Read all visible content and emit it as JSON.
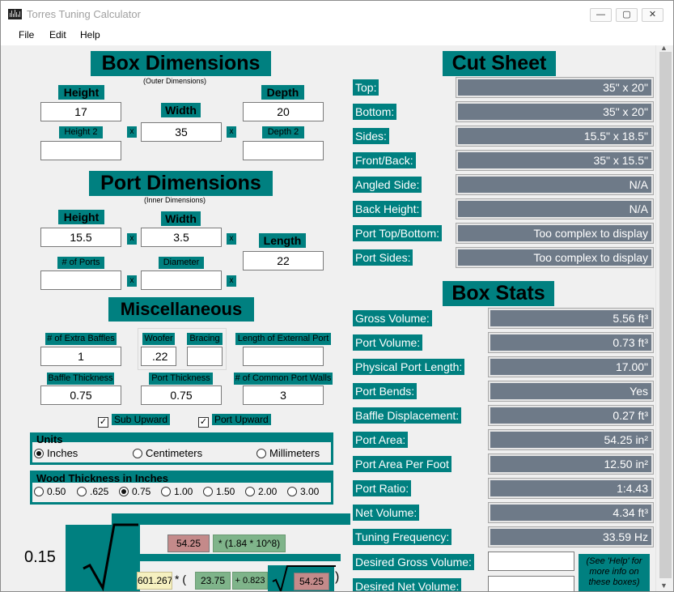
{
  "window": {
    "title": "Torres Tuning Calculator",
    "minimize": "—",
    "maximize": "▢",
    "close": "✕"
  },
  "menu": [
    "File",
    "Edit",
    "Help"
  ],
  "box": {
    "heading": "Box Dimensions",
    "subheading": "(Outer Dimensions)",
    "height_label": "Height",
    "height": "17",
    "width_label": "Width",
    "width": "35",
    "depth_label": "Depth",
    "depth": "20",
    "height2_label": "Height 2",
    "height2": "",
    "depth2_label": "Depth 2",
    "depth2": ""
  },
  "port": {
    "heading": "Port Dimensions",
    "subheading": "(Inner Dimensions)",
    "height_label": "Height",
    "height": "15.5",
    "width_label": "Width",
    "width": "3.5",
    "length_label": "Length",
    "length": "22",
    "ports_label": "# of Ports",
    "ports": "",
    "diameter_label": "Diameter",
    "diameter": ""
  },
  "x_mark": "x",
  "misc": {
    "heading": "Miscellaneous",
    "extra_baffles_label": "# of Extra Baffles",
    "extra_baffles": "1",
    "woofer_label": "Woofer",
    "woofer": ".22",
    "bracing_label": "Bracing",
    "bracing": "",
    "ext_port_label": "Length of External Port",
    "ext_port": "",
    "baffle_thickness_label": "Baffle Thickness",
    "baffle_thickness": "0.75",
    "port_thickness_label": "Port Thickness",
    "port_thickness": "0.75",
    "common_walls_label": "# of Common Port Walls",
    "common_walls": "3",
    "sub_upward": "Sub Upward",
    "port_upward": "Port Upward",
    "check_mark": "✓"
  },
  "units": {
    "title": "Units",
    "options": [
      "Inches",
      "Centimeters",
      "Millimeters"
    ],
    "selected": "Inches"
  },
  "wood": {
    "title": "Wood Thickness in Inches",
    "options": [
      "0.50",
      ".625",
      "0.75",
      "1.00",
      "1.50",
      "2.00",
      "3.00"
    ],
    "selected": "0.75"
  },
  "cut_sheet": {
    "heading": "Cut Sheet",
    "rows": [
      {
        "label": "Top:",
        "value": "35\" x 20\""
      },
      {
        "label": "Bottom:",
        "value": "35\" x 20\""
      },
      {
        "label": "Sides:",
        "value": "15.5\" x 18.5\""
      },
      {
        "label": "Front/Back:",
        "value": "35\" x 15.5\""
      },
      {
        "label": "Angled Side:",
        "value": "N/A"
      },
      {
        "label": "Back Height:",
        "value": "N/A"
      },
      {
        "label": "Port Top/Bottom:",
        "value": "Too complex to display"
      },
      {
        "label": "Port Sides:",
        "value": "Too complex to display"
      }
    ]
  },
  "box_stats": {
    "heading": "Box Stats",
    "rows": [
      {
        "label": "Gross Volume:",
        "value": "5.56 ft³"
      },
      {
        "label": "Port Volume:",
        "value": "0.73 ft³"
      },
      {
        "label": "Physical Port Length:",
        "value": "17.00\""
      },
      {
        "label": "Port Bends:",
        "value": "Yes"
      },
      {
        "label": "Baffle Displacement:",
        "value": "0.27 ft³"
      },
      {
        "label": "Port Area:",
        "value": "54.25 in²"
      },
      {
        "label": "Port Area Per Foot",
        "value": "12.50 in²"
      },
      {
        "label": "Port Ratio:",
        "value": "1:4.43"
      },
      {
        "label": "Net Volume:",
        "value": "4.34 ft³"
      },
      {
        "label": "Tuning Frequency:",
        "value": "33.59 Hz"
      }
    ],
    "desired_gross_label": "Desired Gross Volume:",
    "desired_gross": "",
    "desired_net_label": "Desired Net Volume:",
    "desired_net": "",
    "help_note": "(See 'Help' for more info on these boxes)"
  },
  "formula": {
    "coef": "0.15",
    "area1": "54.25",
    "factor": "* (1.84 * 10^8)",
    "num1": "601.267",
    "op1": "* (",
    "num2": "23.75",
    "op2": "+ 0.823",
    "area2": "54.25",
    "close_paren": ")"
  }
}
